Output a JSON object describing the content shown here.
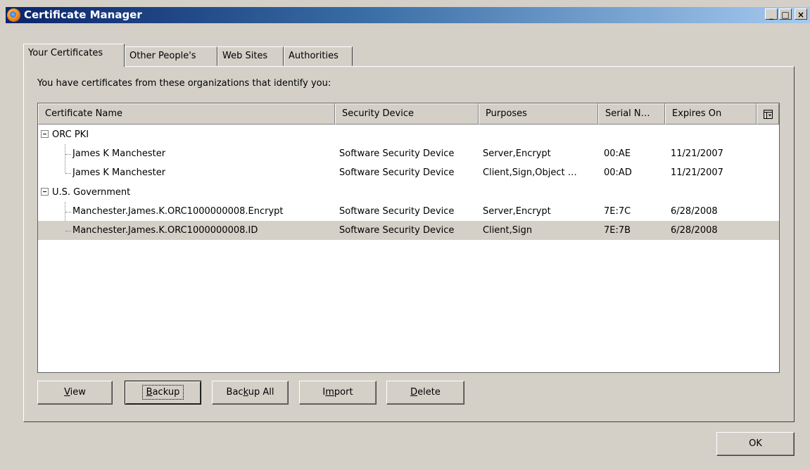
{
  "window": {
    "title": "Certificate Manager",
    "controls": {
      "minimize": "_",
      "maximize": "□",
      "close": "×"
    }
  },
  "tabs": [
    {
      "label": "Your Certificates",
      "active": true
    },
    {
      "label": "Other People's",
      "active": false
    },
    {
      "label": "Web Sites",
      "active": false
    },
    {
      "label": "Authorities",
      "active": false
    }
  ],
  "intro_text": "You have certificates from these organizations that identify you:",
  "columns": {
    "name": "Certificate Name",
    "device": "Security Device",
    "purposes": "Purposes",
    "serial": "Serial N…",
    "expires": "Expires On",
    "picker_icon": "column-picker-icon"
  },
  "groups": [
    {
      "name": "ORC PKI",
      "expanded": true,
      "certs": [
        {
          "name": "James K Manchester",
          "device": "Software Security Device",
          "purposes": "Server,Encrypt",
          "serial": "00:AE",
          "expires": "11/21/2007"
        },
        {
          "name": "James K Manchester",
          "device": "Software Security Device",
          "purposes": "Client,Sign,Object …",
          "serial": "00:AD",
          "expires": "11/21/2007"
        }
      ]
    },
    {
      "name": "U.S. Government",
      "expanded": true,
      "certs": [
        {
          "name": "Manchester.James.K.ORC1000000008.Encrypt",
          "device": "Software Security Device",
          "purposes": "Server,Encrypt",
          "serial": "7E:7C",
          "expires": "6/28/2008"
        },
        {
          "name": "Manchester.James.K.ORC1000000008.ID",
          "device": "Software Security Device",
          "purposes": "Client,Sign",
          "serial": "7E:7B",
          "expires": "6/28/2008",
          "selected": true
        }
      ]
    }
  ],
  "buttons": {
    "view": {
      "pre": "",
      "key": "V",
      "post": "iew"
    },
    "backup": {
      "pre": "",
      "key": "B",
      "post": "ackup",
      "focused": true
    },
    "backup_all": {
      "pre": "Bac",
      "key": "k",
      "post": "up All"
    },
    "import": {
      "pre": "I",
      "key": "m",
      "post": "port"
    },
    "delete": {
      "pre": "",
      "key": "D",
      "post": "elete"
    },
    "ok": "OK"
  },
  "colors": {
    "title_start": "#0a246a",
    "title_end": "#a6caf0",
    "face": "#d4d0c8",
    "selected_row": "#d4d0c8"
  }
}
